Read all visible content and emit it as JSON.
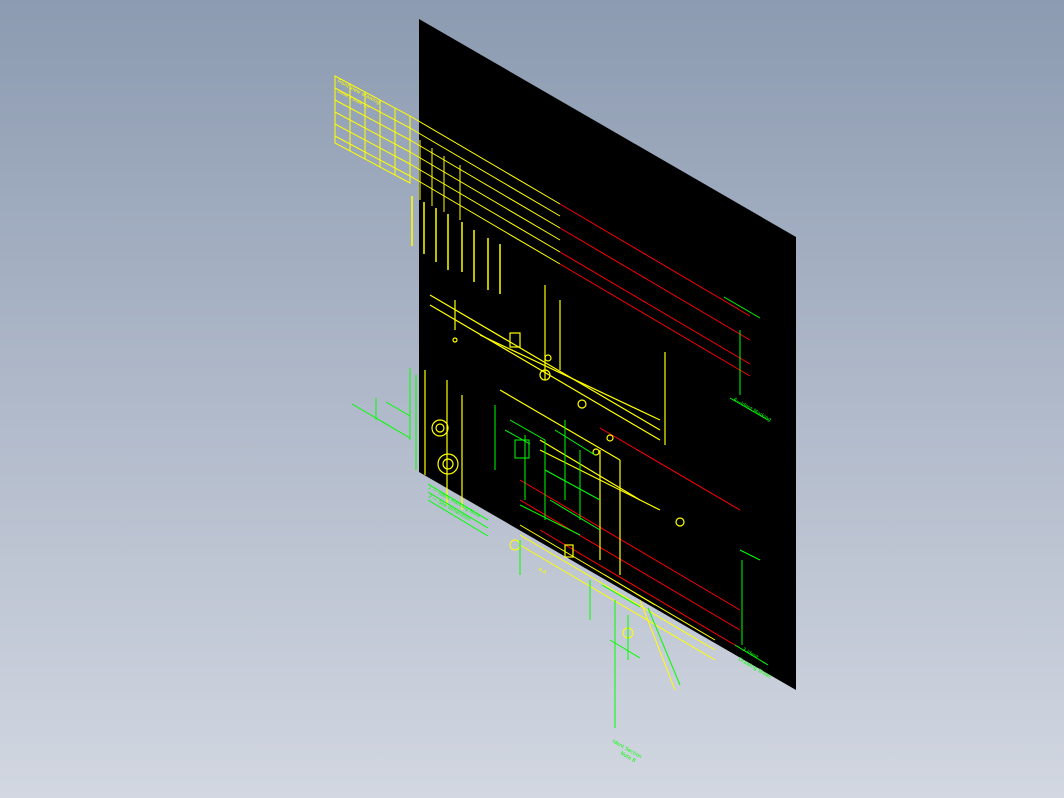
{
  "viewport": {
    "background_top": "#8c9bb1",
    "background_bottom": "#d2d7e1"
  },
  "drawing": {
    "sheet_color": "#000000",
    "colors": {
      "yellow": "#ffff00",
      "green": "#00ff00",
      "red": "#ff0000",
      "white": "#ffffff"
    }
  },
  "labels": {
    "table_title": "Front view drawing",
    "table_sub": "Detail  B  Scale  1:5",
    "note_a": "A—Ident Marking",
    "note_b": "1 — Ident Marking Note",
    "note_c": "2 — See dimension",
    "section": "A-A",
    "title_block_1": "3 Ident",
    "title_block_2": "Drawing  Sheet",
    "bottom_1": "Ident Section",
    "bottom_2": "Note B"
  }
}
